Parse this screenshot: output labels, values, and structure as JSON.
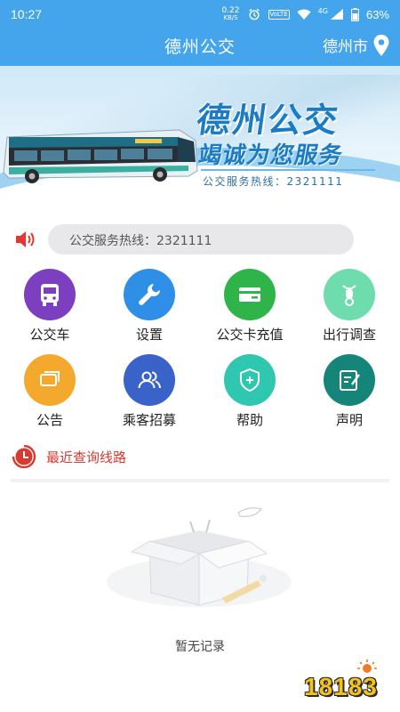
{
  "status_bar": {
    "time": "10:27",
    "net_speed_value": "0.22",
    "net_speed_unit": "KB/S",
    "volte": "VoLTE",
    "signal": "4G",
    "battery": "63%"
  },
  "header": {
    "title": "德州公交",
    "city": "德州市"
  },
  "banner": {
    "title": "德州公交",
    "slogan": "竭诚为您服务",
    "hotline": "公交服务热线：2321111"
  },
  "notice": {
    "text": "公交服务热线：2321111"
  },
  "menu": [
    {
      "label": "公交车",
      "icon": "bus-icon",
      "color": "#7b3fc0"
    },
    {
      "label": "设置",
      "icon": "wrench-icon",
      "color": "#2f8ee5"
    },
    {
      "label": "公交卡充值",
      "icon": "card-icon",
      "color": "#2fb44a"
    },
    {
      "label": "出行调查",
      "icon": "bike-icon",
      "color": "#6fdcae"
    },
    {
      "label": "公告",
      "icon": "chat-icon",
      "color": "#f4a92d"
    },
    {
      "label": "乘客招募",
      "icon": "users-icon",
      "color": "#3a63c9"
    },
    {
      "label": "帮助",
      "icon": "shield-plus-icon",
      "color": "#2fc7b0"
    },
    {
      "label": "声明",
      "icon": "note-icon",
      "color": "#15857a"
    }
  ],
  "recent": {
    "title": "最近查询线路",
    "empty_text": "暂无记录"
  },
  "watermark": {
    "text": "18183"
  }
}
